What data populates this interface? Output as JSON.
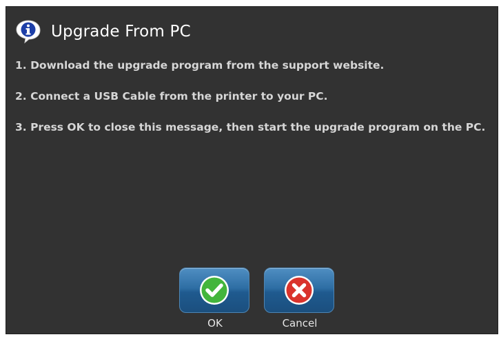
{
  "dialog": {
    "title": "Upgrade From PC",
    "title_icon": "info-icon",
    "steps": [
      "1. Download the upgrade program from the support website.",
      "2. Connect a USB Cable from the printer to your PC.",
      "3. Press OK to close this message, then start the upgrade program on the PC."
    ]
  },
  "buttons": {
    "ok": {
      "label": "OK",
      "icon": "checkmark-icon",
      "color": "#3fb13a"
    },
    "cancel": {
      "label": "Cancel",
      "icon": "x-icon",
      "color": "#d8302a"
    }
  }
}
